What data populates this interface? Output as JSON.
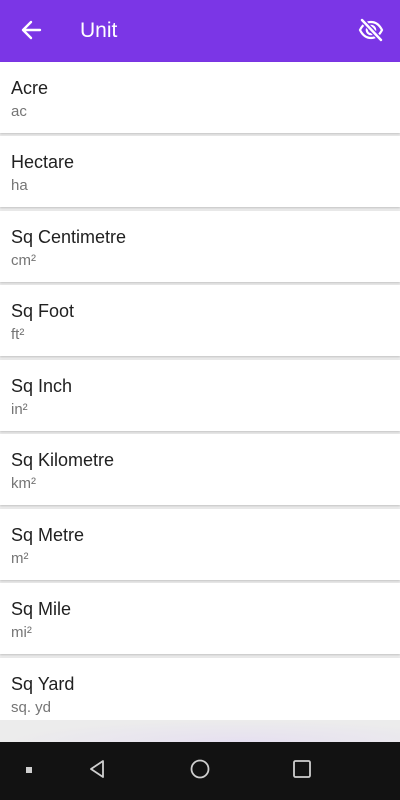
{
  "appbar": {
    "title": "Unit",
    "back_icon": "arrow-left-icon",
    "visibility_icon": "eye-off-icon",
    "color": "#7b36e6"
  },
  "units": [
    {
      "name": "Acre",
      "abbr": "ac"
    },
    {
      "name": "Hectare",
      "abbr": "ha"
    },
    {
      "name": "Sq Centimetre",
      "abbr": "cm²"
    },
    {
      "name": "Sq Foot",
      "abbr": "ft²"
    },
    {
      "name": "Sq Inch",
      "abbr": "in²"
    },
    {
      "name": "Sq Kilometre",
      "abbr": "km²"
    },
    {
      "name": "Sq Metre",
      "abbr": "m²"
    },
    {
      "name": "Sq Mile",
      "abbr": "mi²"
    },
    {
      "name": "Sq Yard",
      "abbr": "sq. yd"
    }
  ],
  "navbar": {
    "icons": [
      "recent-dot-icon",
      "back-triangle-icon",
      "home-circle-icon",
      "overview-square-icon"
    ]
  }
}
